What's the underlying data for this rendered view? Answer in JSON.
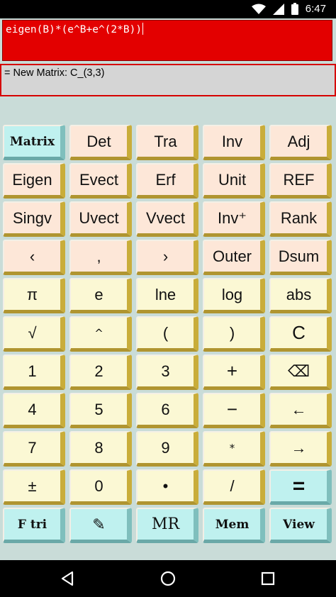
{
  "status": {
    "time": "6:47"
  },
  "input": {
    "expression": "eigen(B)*(e^B+e^(2*B))"
  },
  "result": {
    "text": "= New Matrix: C_(3,3)"
  },
  "keys": [
    [
      "Matrix",
      "Det",
      "Tra",
      "Inv",
      "Adj"
    ],
    [
      "Eigen",
      "Evect",
      "Erf",
      "Unit",
      "REF"
    ],
    [
      "Singv",
      "Uvect",
      "Vvect",
      "Inv⁺",
      "Rank"
    ],
    [
      "‹",
      ",",
      "›",
      "Outer",
      "Dsum"
    ],
    [
      "π",
      "e",
      "lne",
      "log",
      "abs"
    ],
    [
      "√",
      "^",
      "(",
      ")",
      "C"
    ],
    [
      "1",
      "2",
      "3",
      "+",
      "⌫"
    ],
    [
      "4",
      "5",
      "6",
      "−",
      "←"
    ],
    [
      "7",
      "8",
      "9",
      "*",
      "→"
    ],
    [
      "±",
      "0",
      "•",
      "/",
      "="
    ],
    [
      "F tri",
      "✎",
      "MR",
      "Mem",
      "View"
    ]
  ],
  "colors": {
    "input_bg": "#e30000",
    "result_border": "#d60000",
    "app_bg": "#c9dcd8"
  }
}
